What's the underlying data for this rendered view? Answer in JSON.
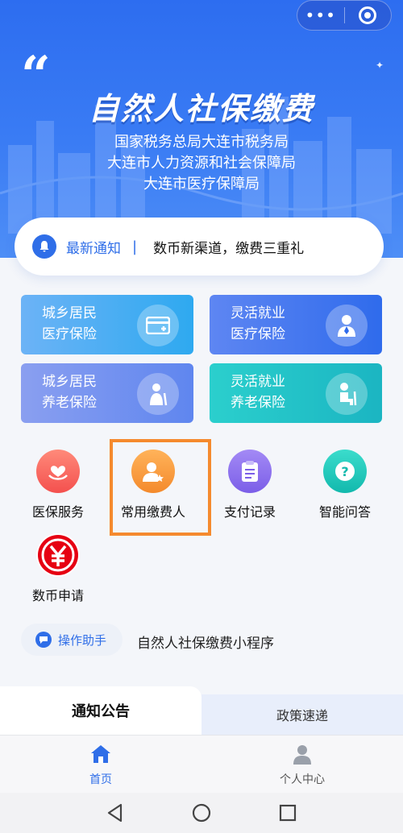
{
  "capsule": {
    "more_icon": "more-dots-icon",
    "close_icon": "target-close-icon"
  },
  "hero": {
    "title": "自然人社保缴费",
    "subtitle_lines": [
      "国家税务总局大连市税务局",
      "大连市人力资源和社会保障局",
      "大连市医疗保障局"
    ]
  },
  "notice": {
    "label": "最新通知",
    "separator": "|",
    "text": "数币新渠道，缴费三重礼"
  },
  "cards": [
    {
      "line1": "城乡居民",
      "line2": "医疗保险",
      "icon": "medical-card-icon"
    },
    {
      "line1": "灵活就业",
      "line2": "医疗保险",
      "icon": "worker-icon"
    },
    {
      "line1": "城乡居民",
      "line2": "养老保险",
      "icon": "elder-icon"
    },
    {
      "line1": "灵活就业",
      "line2": "养老保险",
      "icon": "elder-seated-icon"
    }
  ],
  "services": [
    {
      "label": "医保服务",
      "icon": "heart-hand-icon"
    },
    {
      "label": "常用缴费人",
      "icon": "user-star-icon"
    },
    {
      "label": "支付记录",
      "icon": "clipboard-icon"
    },
    {
      "label": "智能问答",
      "icon": "question-icon"
    },
    {
      "label": "数币申请",
      "icon": "digital-yuan-icon"
    }
  ],
  "assistant": {
    "button_label": "操作助手",
    "text": "自然人社保缴费小程序"
  },
  "tabs": [
    {
      "label": "通知公告",
      "active": true
    },
    {
      "label": "政策速递",
      "active": false
    }
  ],
  "bottom_nav": [
    {
      "label": "首页",
      "icon": "home-icon",
      "active": true
    },
    {
      "label": "个人中心",
      "icon": "person-icon",
      "active": false
    }
  ],
  "colors": {
    "primary": "#2f6ee8",
    "highlight": "#f58a2e"
  }
}
